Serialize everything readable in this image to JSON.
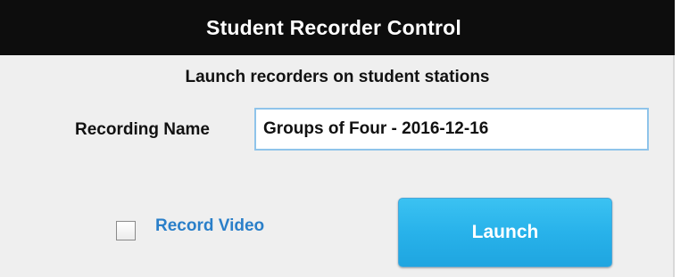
{
  "window": {
    "title": "Student Recorder Control"
  },
  "main": {
    "subtitle": "Launch recorders on student stations",
    "recording_name": {
      "label": "Recording Name",
      "value": "Groups of Four - 2016-12-16"
    },
    "record_video": {
      "label": "Record Video",
      "checked": false
    },
    "launch_button": {
      "label": "Launch"
    }
  },
  "colors": {
    "title_bar": "#0d0d0d",
    "panel_background": "#efefef",
    "input_border": "#8fc4ea",
    "link_blue": "#2a7fc9",
    "button_blue": "#28b2ea"
  }
}
